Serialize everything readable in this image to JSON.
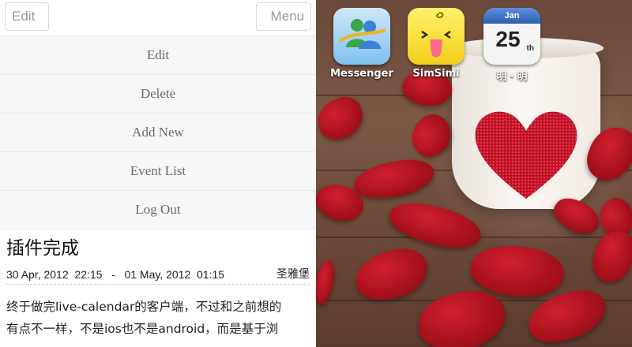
{
  "header": {
    "edit_button": "Edit -",
    "menu_button": "Menu -"
  },
  "menu": {
    "items": [
      "Edit",
      "Delete",
      "Add New",
      "Event List",
      "Log Out"
    ]
  },
  "post": {
    "title": "插件完成",
    "dates": "30 Apr, 2012  22:15   -   01 May, 2012  01:15",
    "location": "圣雅堡",
    "body_line1": "终于做完live-calendar的客户端，不过和之前想的",
    "body_line2": "有点不一样，不是ios也不是android，而是基于浏"
  },
  "home_screen": {
    "apps": [
      {
        "label": "Messenger",
        "icon": "messenger-icon"
      },
      {
        "label": "SimSimi",
        "icon": "simsimi-icon"
      },
      {
        "label": "明・明",
        "icon": "calendar-icon"
      }
    ],
    "calendar_icon": {
      "month": "Jan",
      "day": "25",
      "suffix": "th"
    }
  },
  "colors": {
    "petal": "#b0131f",
    "heart": "#c4142a",
    "wood": "#6b4a3b"
  }
}
